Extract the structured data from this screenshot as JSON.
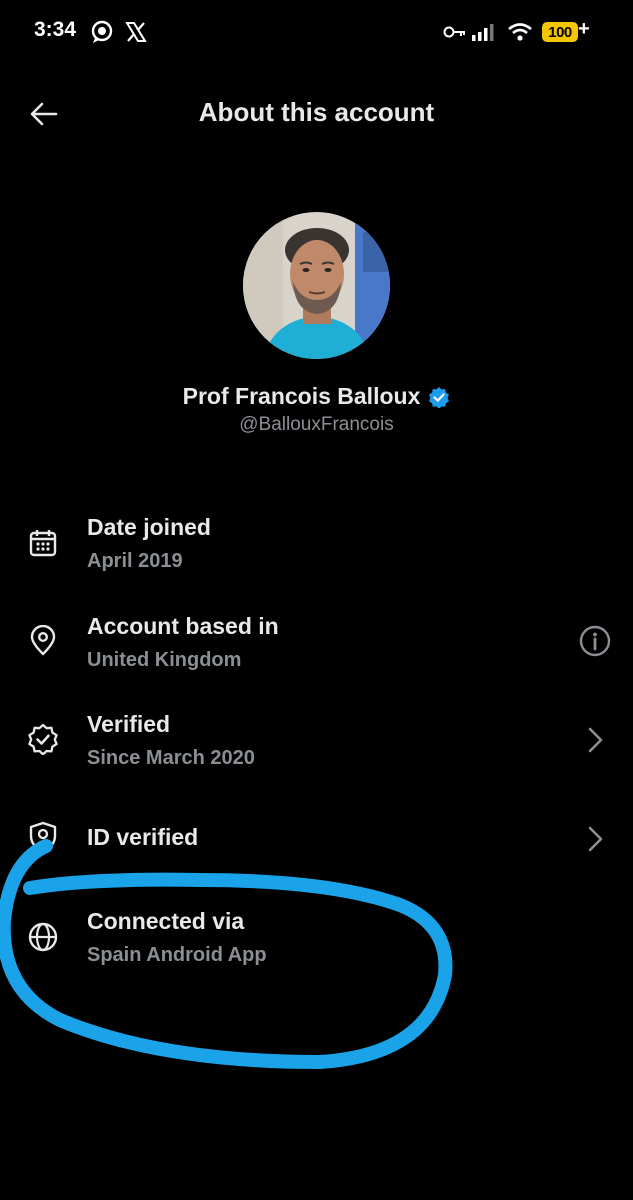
{
  "status_bar": {
    "time": "3:34",
    "battery": "100",
    "battery_suffix": "+",
    "icons": [
      "chat-bubble-icon",
      "x-logo-icon",
      "key-icon",
      "signal-icon",
      "wifi-icon",
      "battery-icon"
    ]
  },
  "header": {
    "title": "About this account",
    "back_icon": "arrow-left-icon"
  },
  "profile": {
    "name": "Prof Francois Balloux",
    "handle": "@BallouxFrancois",
    "verified_badge_color": "#1d9bf0"
  },
  "rows": [
    {
      "label": "Date joined",
      "value": "April 2019",
      "icon": "calendar-icon"
    },
    {
      "label": "Account based in",
      "value": "United Kingdom",
      "icon": "location-pin-icon",
      "trailing": "info-icon"
    },
    {
      "label": "Verified",
      "value": "Since March 2020",
      "icon": "verified-badge-icon",
      "trailing": "chevron-right-icon"
    },
    {
      "label": "ID verified",
      "value": "",
      "icon": "id-shield-icon",
      "trailing": "chevron-right-icon"
    },
    {
      "label": "Connected via",
      "value": "Spain Android App",
      "icon": "globe-icon"
    }
  ],
  "colors": {
    "background": "#000000",
    "primary_text": "#e7e9ea",
    "secondary_text": "#8b8f94",
    "accent": "#1d9bf0",
    "annotation": "#1aa3e8",
    "battery": "#f6c500"
  }
}
